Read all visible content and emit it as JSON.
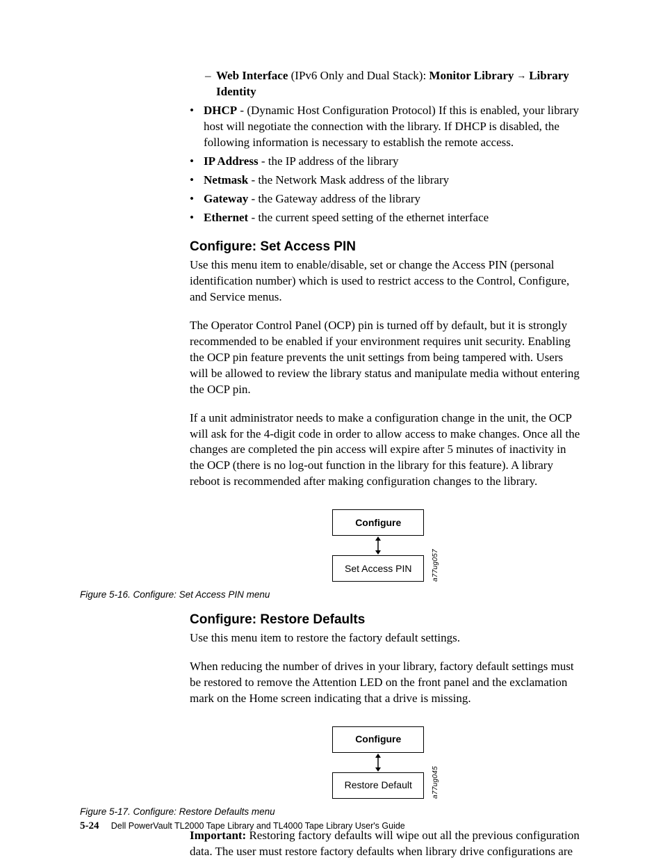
{
  "top": {
    "webiface_item": {
      "bold1": "Web Interface",
      "plain1": " (IPv6 Only and Dual Stack): ",
      "bold2": "Monitor Library",
      "arrow": " → ",
      "bold3": "Library Identity"
    },
    "dhcp": {
      "bold": "DHCP",
      "text": " - (Dynamic Host Configuration Protocol) If this is enabled, your library host will negotiate the connection with the library. If DHCP is disabled, the following information is necessary to establish the remote access."
    },
    "ip": {
      "bold": "IP Address",
      "text": " - the IP address of the library"
    },
    "netmask": {
      "bold": "Netmask",
      "text": " - the Network Mask address of the library"
    },
    "gateway": {
      "bold": "Gateway",
      "text": " - the Gateway address of the library"
    },
    "ethernet": {
      "bold": "Ethernet",
      "text": " - the current speed setting of the ethernet interface"
    }
  },
  "sec1": {
    "heading": "Configure: Set Access PIN",
    "p1": "Use this menu item to enable/disable, set or change the Access PIN (personal identification number) which is used to restrict access to the Control, Configure, and Service menus.",
    "p2": "The Operator Control Panel (OCP) pin is turned off by default, but it is strongly recommended to be enabled if your environment requires unit security. Enabling the OCP pin feature prevents the unit settings from being tampered with. Users will be allowed to review the library status and manipulate media without entering the OCP pin.",
    "p3": "If a unit administrator needs to make a configuration change in the unit, the OCP will ask for the 4-digit code in order to allow access to make changes. Once all the changes are completed the pin access will expire after 5 minutes of inactivity in the OCP (there is no log-out function in the library for this feature). A library reboot is recommended after making configuration changes to the library."
  },
  "fig1": {
    "box_top": "Configure",
    "box_bot": "Set Access PIN",
    "vlabel": "a77ug057",
    "caption": "Figure 5-16. Configure: Set Access PIN menu"
  },
  "sec2": {
    "heading": "Configure: Restore Defaults",
    "p1": "Use this menu item to restore the factory default settings.",
    "p2": "When reducing the number of drives in your library, factory default settings must be restored to remove the Attention LED on the front panel and the exclamation mark on the Home screen indicating that a drive is missing."
  },
  "fig2": {
    "box_top": "Configure",
    "box_bot": "Restore Default",
    "vlabel": "a77ug045",
    "caption": "Figure 5-17. Configure: Restore Defaults menu"
  },
  "sec3": {
    "important_label": "Important:",
    "important_text": " Restoring factory defaults will wipe out all the previous configuration data. The user must restore factory defaults when library drive configurations are"
  },
  "footer": {
    "page": "5-24",
    "title": "Dell PowerVault TL2000 Tape Library and TL4000 Tape Library User's Guide"
  },
  "glyphs": {
    "bullet": "•",
    "dash": "–"
  }
}
